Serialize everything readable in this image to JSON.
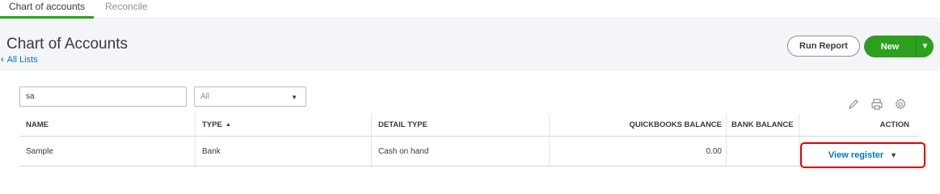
{
  "tabs": [
    {
      "label": "Chart of accounts",
      "active": true
    },
    {
      "label": "Reconcile",
      "active": false
    }
  ],
  "header": {
    "title": "Chart of Accounts",
    "back_link": "All Lists",
    "run_report_label": "Run Report",
    "new_label": "New"
  },
  "filters": {
    "search_value": "sa",
    "type_selected": "All"
  },
  "table": {
    "columns": {
      "name": "NAME",
      "type": "TYPE",
      "detail_type": "DETAIL TYPE",
      "quickbooks_balance": "QUICKBOOKS BALANCE",
      "bank_balance": "BANK BALANCE",
      "action": "ACTION"
    },
    "rows": [
      {
        "name": "Sample",
        "type": "Bank",
        "detail_type": "Cash on hand",
        "quickbooks_balance": "0.00",
        "bank_balance": "",
        "action": "View register"
      }
    ]
  },
  "icons": [
    "pencil-icon",
    "printer-icon",
    "gear-icon"
  ],
  "colors": {
    "accent_green": "#2ca01c",
    "link_blue": "#0077c5",
    "highlight_red": "#e00000"
  }
}
